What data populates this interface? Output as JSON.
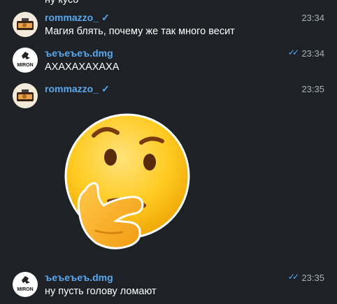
{
  "previous_text": "ну кусо",
  "messages": [
    {
      "sender": "rommazzo_",
      "verified": "✓",
      "time": "23:34",
      "text": "Магия блять, почему же так много весит"
    },
    {
      "sender": "ъеъеъеъ.dmg",
      "status": "✓✓",
      "time": "23:34",
      "text": "АХАХАХАХАХА"
    },
    {
      "sender": "rommazzo_",
      "verified": "✓",
      "time": "23:35",
      "sticker": "thinking-face-emoji"
    },
    {
      "sender": "ъеъеъеъ.dmg",
      "status": "✓✓",
      "time": "23:35",
      "text": "ну пусть голову ломают"
    }
  ],
  "avatar_labels": {
    "bebe": "MIRON"
  },
  "colors": {
    "background": "#1e2126",
    "name": "#5aa9ef",
    "time": "#a8b1bb"
  }
}
